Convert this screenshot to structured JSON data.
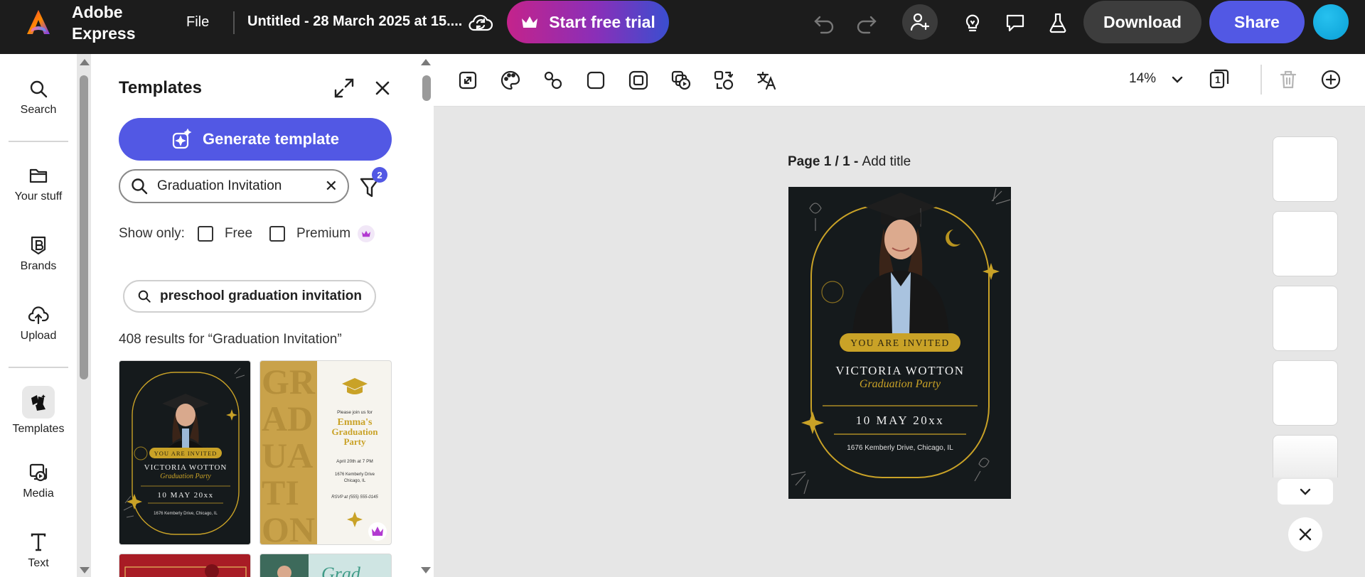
{
  "app": {
    "brand_line1": "Adobe",
    "brand_line2": "Express",
    "file_label": "File",
    "doc_title": "Untitled - 28 March 2025 at 15....",
    "trial_label": "Start free trial",
    "download_label": "Download",
    "share_label": "Share",
    "accent": "#5258e4",
    "trial_gradient": [
      "#c4238b",
      "#3a4ed0"
    ]
  },
  "rail": {
    "items": [
      {
        "label": "Search",
        "icon": "search-icon"
      },
      {
        "label": "Your stuff",
        "icon": "folder-icon"
      },
      {
        "label": "Brands",
        "icon": "brand-icon"
      },
      {
        "label": "Upload",
        "icon": "cloud-upload-icon"
      },
      {
        "label": "Templates",
        "icon": "templates-icon",
        "active": true
      },
      {
        "label": "Media",
        "icon": "media-icon"
      },
      {
        "label": "Text",
        "icon": "text-icon"
      }
    ]
  },
  "panel": {
    "title": "Templates",
    "generate_label": "Generate template",
    "search_value": "Graduation Invitation",
    "filter_count": "2",
    "show_only": "Show only:",
    "free_label": "Free",
    "premium_label": "Premium",
    "suggestion": "preschool graduation invitation",
    "results": "408 results for “Graduation Invitation”"
  },
  "thumb1": {
    "invited": "YOU ARE INVITED",
    "name": "VICTORIA WOTTON",
    "script": "Graduation Party",
    "date": "10 MAY 20xx",
    "address": "1676 Kemberly Drive, Chicago, IL"
  },
  "thumb2": {
    "big_letters": [
      "GR",
      "AD",
      "UA",
      "TI",
      "ON"
    ],
    "join": "Please join us for",
    "name": "Emma's",
    "title1": "Graduation",
    "title2": "Party",
    "date": "April 20th at 7 PM",
    "address1": "1676 Kemberly Drive",
    "address2": "Chicago, IL",
    "rsvp": "RSVP at (555) 555-0145"
  },
  "thumb4": {
    "script": "Grad"
  },
  "canvas": {
    "zoom": "14%",
    "page_prefix": "Page 1 / 1 - ",
    "page_title": "Add title",
    "invited": "YOU ARE INVITED",
    "name": "VICTORIA WOTTON",
    "script": "Graduation Party",
    "date": "10 MAY 20xx",
    "address": "1676 Kemberly Drive, Chicago, IL",
    "gold": "#c9a227"
  },
  "toolbar": {
    "page_count": "1"
  }
}
